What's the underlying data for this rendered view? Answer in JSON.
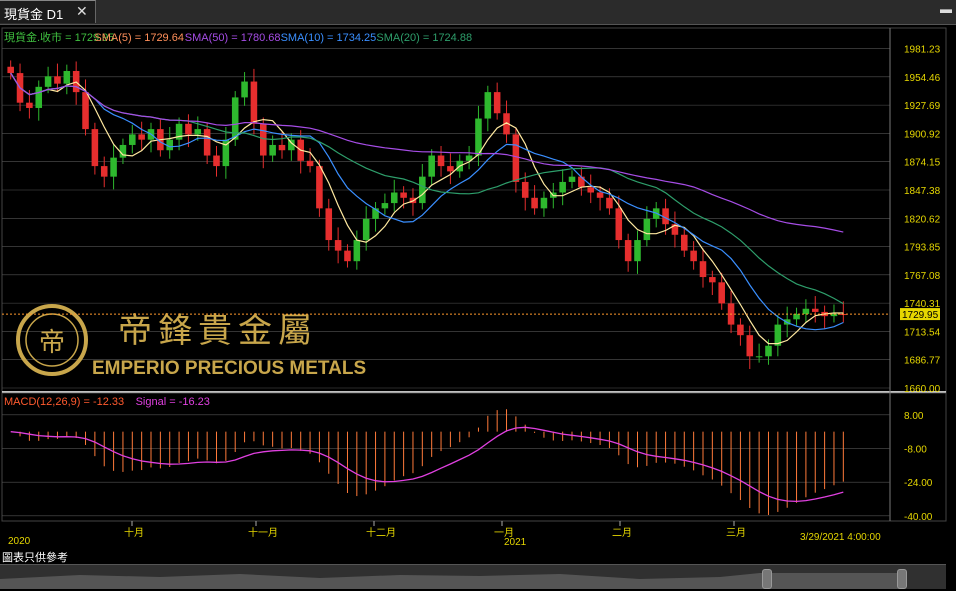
{
  "tab": {
    "title": "現貨金 D1",
    "close_glyph": "✕"
  },
  "menu_glyph": "▬",
  "legend_main": [
    {
      "text": "現貨金.收市 = 1729.95",
      "color": "#3fbf3f"
    },
    {
      "text": "SMA(5) = 1729.64",
      "color": "#ff8f5a"
    },
    {
      "text": "SMA(50) = 1780.68",
      "color": "#a64de6"
    },
    {
      "text": "SMA(10) = 1734.25",
      "color": "#3a8fff"
    },
    {
      "text": "SMA(20) = 1724.88",
      "color": "#2e9e6b"
    }
  ],
  "legend_macd": [
    {
      "text": "MACD(12,26,9) = -12.33",
      "color": "#ff5a2e"
    },
    {
      "text": "Signal = -16.23",
      "color": "#e040e0"
    }
  ],
  "price_axis": [
    "1981.23",
    "1954.46",
    "1927.69",
    "1900.92",
    "1874.15",
    "1847.38",
    "1820.62",
    "1793.85",
    "1767.08",
    "1740.31",
    "1713.54",
    "1686.77",
    "1660.00"
  ],
  "current_price": "1729.95",
  "macd_axis": [
    "8.00",
    "-8.00",
    "-24.00",
    "-40.00"
  ],
  "time_axis": {
    "months": [
      "十月",
      "十一月",
      "十二月",
      "一月",
      "二月",
      "三月"
    ],
    "years": [
      "2020",
      "2021"
    ],
    "end_label": "3/29/2021 4:00:00"
  },
  "logo": {
    "chinese": "帝鋒貴金屬",
    "english": "EMPERIO PRECIOUS METALS"
  },
  "footer_note": "圖表只供參考",
  "colors": {
    "up": "#2eb82e",
    "down": "#e62e2e",
    "sma5": "#ffe9a0",
    "sma10": "#3a8fff",
    "sma20": "#2e9e6b",
    "sma50": "#a64de6",
    "macd_hist": "#ff7a3a",
    "signal": "#e040e0",
    "gold": "#c8a64b"
  },
  "chart_data": {
    "type": "candlestick",
    "series_close": [
      1958,
      1930,
      1925,
      1945,
      1955,
      1948,
      1960,
      1940,
      1905,
      1870,
      1860,
      1878,
      1890,
      1900,
      1895,
      1905,
      1885,
      1895,
      1910,
      1900,
      1905,
      1880,
      1870,
      1895,
      1935,
      1950,
      1910,
      1880,
      1890,
      1885,
      1895,
      1875,
      1870,
      1830,
      1800,
      1790,
      1780,
      1800,
      1820,
      1830,
      1835,
      1845,
      1840,
      1835,
      1860,
      1880,
      1870,
      1865,
      1875,
      1880,
      1915,
      1940,
      1920,
      1900,
      1855,
      1840,
      1830,
      1840,
      1845,
      1855,
      1860,
      1850,
      1845,
      1840,
      1830,
      1800,
      1780,
      1800,
      1820,
      1830,
      1815,
      1805,
      1790,
      1780,
      1765,
      1760,
      1740,
      1720,
      1710,
      1690,
      1690,
      1700,
      1720,
      1725,
      1730,
      1735,
      1732,
      1728,
      1730,
      1729.95
    ],
    "price_range": [
      1660,
      1995
    ],
    "macd_range": [
      -42,
      16
    ]
  }
}
